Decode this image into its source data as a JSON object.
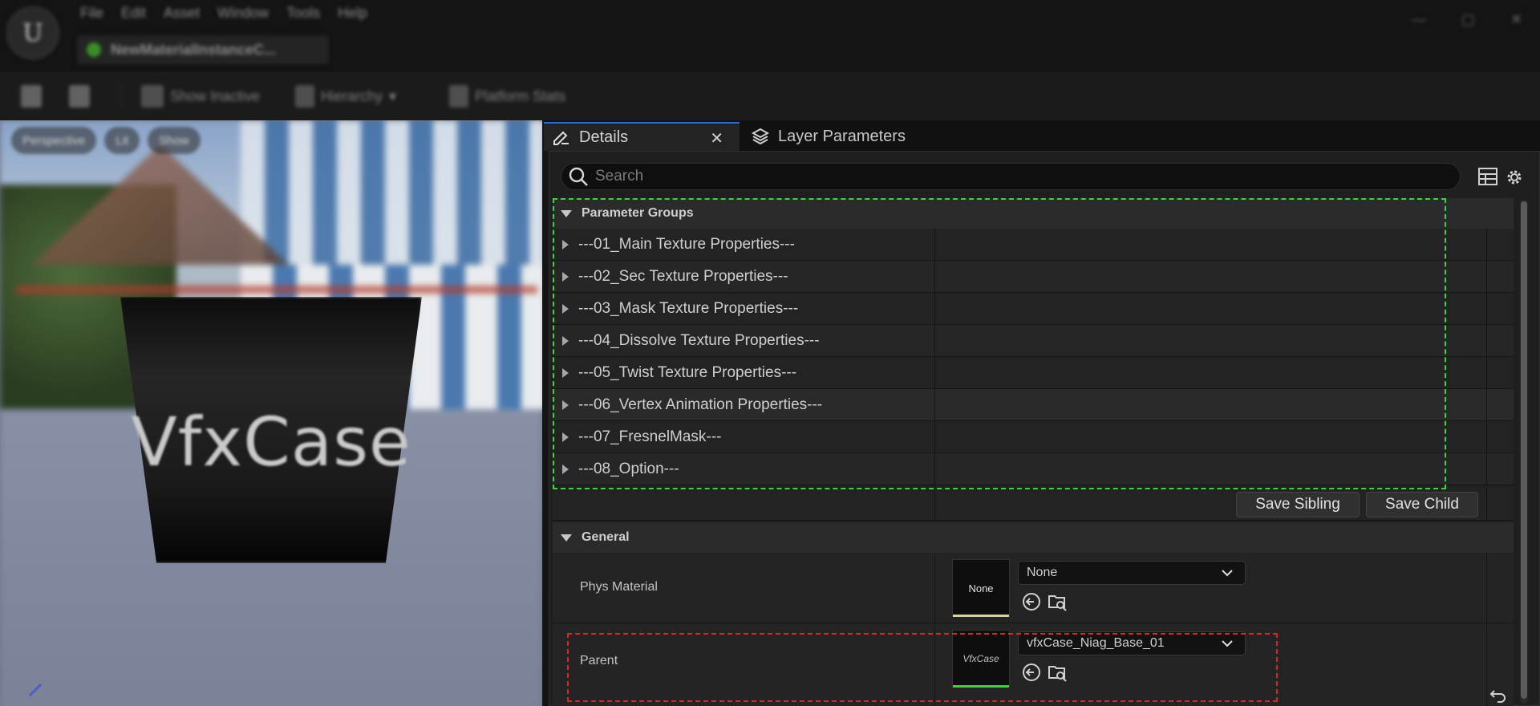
{
  "app": {
    "menu": [
      "File",
      "Edit",
      "Asset",
      "Window",
      "Tools",
      "Help"
    ],
    "asset_tab": "NewMaterialInstanceC...",
    "window_controls": [
      "—",
      "▢",
      "✕"
    ]
  },
  "toolbar": {
    "show_inactive": "Show Inactive",
    "hierarchy": "Hierarchy",
    "platform_stats": "Platform Stats"
  },
  "viewport": {
    "chips": [
      "Perspective",
      "Lit",
      "Show"
    ],
    "logo_text": "VfxCase"
  },
  "tabs": {
    "details": "Details",
    "layer_parameters": "Layer Parameters",
    "close_glyph": "✕"
  },
  "search": {
    "placeholder": "Search"
  },
  "parameter_groups": {
    "title": "Parameter Groups",
    "items": [
      "---01_Main Texture Properties---",
      "---02_Sec Texture Properties---",
      "---03_Mask Texture Properties---",
      "---04_Dissolve Texture  Properties---",
      "---05_Twist Texture Properties---",
      "---06_Vertex Animation Properties---",
      "---07_FresnelMask---",
      "---08_Option---"
    ]
  },
  "actions": {
    "save_sibling": "Save Sibling",
    "save_child": "Save Child"
  },
  "general": {
    "title": "General",
    "phys_material": {
      "label": "Phys Material",
      "thumb_text": "None",
      "value": "None",
      "thumb_bar_color": "#d9d29a"
    },
    "parent": {
      "label": "Parent",
      "thumb_text": "VfxCase",
      "value": "vfxCase_Niag_Base_01",
      "thumb_bar_color": "#3fd23f"
    }
  },
  "colors": {
    "highlight_green": "#3fd23f",
    "highlight_red": "#d62a2a",
    "tab_accent": "#2f6cd6"
  }
}
